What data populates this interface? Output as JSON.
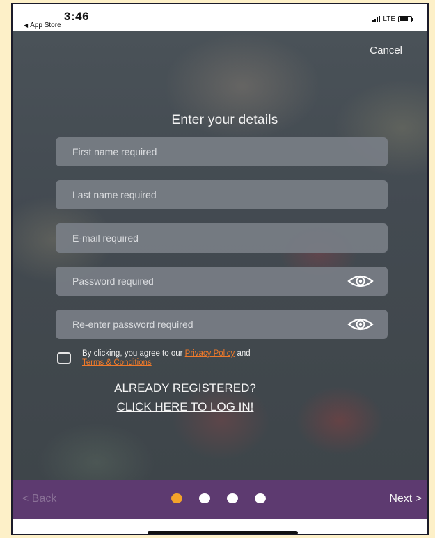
{
  "status_bar": {
    "time": "3:46",
    "back_app": "App Store",
    "network": "LTE"
  },
  "header": {
    "cancel_label": "Cancel"
  },
  "form": {
    "title": "Enter your details",
    "fields": {
      "first_name_placeholder": "First name required",
      "last_name_placeholder": "Last name required",
      "email_placeholder": "E-mail required",
      "password_placeholder": "Password required",
      "repassword_placeholder": "Re-enter password required"
    },
    "terms": {
      "prefix": "By clicking, you agree to our ",
      "privacy_link": "Privacy Policy",
      "middle": " and",
      "terms_link": "Terms & Conditions"
    },
    "login": {
      "line1": "ALREADY REGISTERED?",
      "line2": "CLICK HERE TO LOG IN!"
    }
  },
  "nav": {
    "back_label": "< Back",
    "next_label": "Next >",
    "page_count": 4,
    "active_page": 1
  },
  "colors": {
    "accent_orange": "#f3a32a",
    "link_orange": "#f07a2a",
    "bar_purple": "#5d3a70"
  }
}
